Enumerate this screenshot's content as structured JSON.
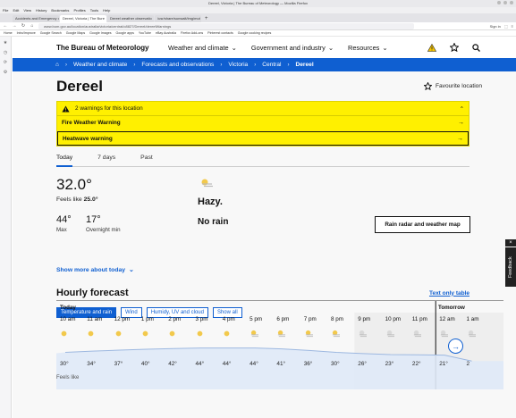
{
  "browser": {
    "window_title": "Dereel, Victoria | The Bureau of Meteorology — Mozilla Firefox",
    "menu": [
      "File",
      "Edit",
      "View",
      "History",
      "Bookmarks",
      "Profiles",
      "Tools",
      "Help"
    ],
    "tabs": [
      {
        "label": "Accidents and Emergency • S"
      },
      {
        "label": "Dereel, Victoria | The Bure"
      },
      {
        "label": "Dereel weather observatio"
      },
      {
        "label": "/usr/share/sunwait/img/mut"
      }
    ],
    "url": "www.bom.gov.au/location/australia/victoria/central/o8827/Dereel/dereelWarnings",
    "nav_right": [
      "Sign in"
    ],
    "bookmarks": [
      "Home",
      "Intro/Improve",
      "Google Search",
      "Google Maps",
      "Google Images",
      "Google apps",
      "YouTube",
      "eBay Australia",
      "Firefox Add-ons",
      "Pinterest contacts",
      "Google cooking recipes"
    ]
  },
  "site": {
    "logo": "The Bureau of Meteorology",
    "nav": [
      "Weather and climate",
      "Government and industry",
      "Resources"
    ]
  },
  "breadcrumb": [
    "Weather and climate",
    "Forecasts and observations",
    "Victoria",
    "Central",
    "Dereel"
  ],
  "location": {
    "title": "Dereel",
    "favourite": "Favourite location"
  },
  "warnings": {
    "summary": "2 warnings for this location",
    "items": [
      "Fire Weather Warning",
      "Heatwave warning"
    ]
  },
  "day_tabs": [
    "Today",
    "7 days",
    "Past"
  ],
  "today": {
    "temp": "32.0°",
    "feels_label": "Feels like",
    "feels_value": "25.0°",
    "max_value": "44°",
    "max_label": "Max",
    "overnight_value": "17°",
    "overnight_label": "Overnight min",
    "condition": "Hazy.",
    "rain": "No rain",
    "radar_button": "Rain radar and weather map"
  },
  "show_more": "Show more about today",
  "hourly": {
    "title": "Hourly forecast",
    "text_only": "Text only table",
    "filters": [
      "Temperature and rain",
      "Wind",
      "Humidy, UV and cloud",
      "Show all"
    ],
    "day_labels": {
      "today": "Today",
      "tomorrow": "Tomorrow"
    },
    "times": [
      "10 am",
      "11 am",
      "12 pm",
      "1 pm",
      "2 pm",
      "3 pm",
      "4 pm",
      "5 pm",
      "6 pm",
      "7 pm",
      "8 pm",
      "9 pm",
      "10 pm",
      "11 pm",
      "12 am",
      "1 am"
    ],
    "temps": [
      "30°",
      "34°",
      "37°",
      "40°",
      "42°",
      "44°",
      "44°",
      "44°",
      "41°",
      "36°",
      "30°",
      "26°",
      "23°",
      "22°",
      "21°",
      "2"
    ],
    "icons": [
      "sun-icon",
      "sun-icon",
      "sun-icon",
      "sun-icon",
      "sun-icon",
      "sun-icon",
      "sun-icon",
      "haze-icon",
      "haze-icon",
      "haze-icon",
      "haze-icon",
      "moon-haze-icon",
      "moon-haze-icon",
      "moon-haze-icon",
      "moon-haze-icon",
      "moon-haze-icon"
    ],
    "feels_row": "Feels like"
  },
  "feedback": "Feedback",
  "colors": {
    "brand_blue": "#0f5fd1",
    "warning_yellow": "#fff000"
  }
}
